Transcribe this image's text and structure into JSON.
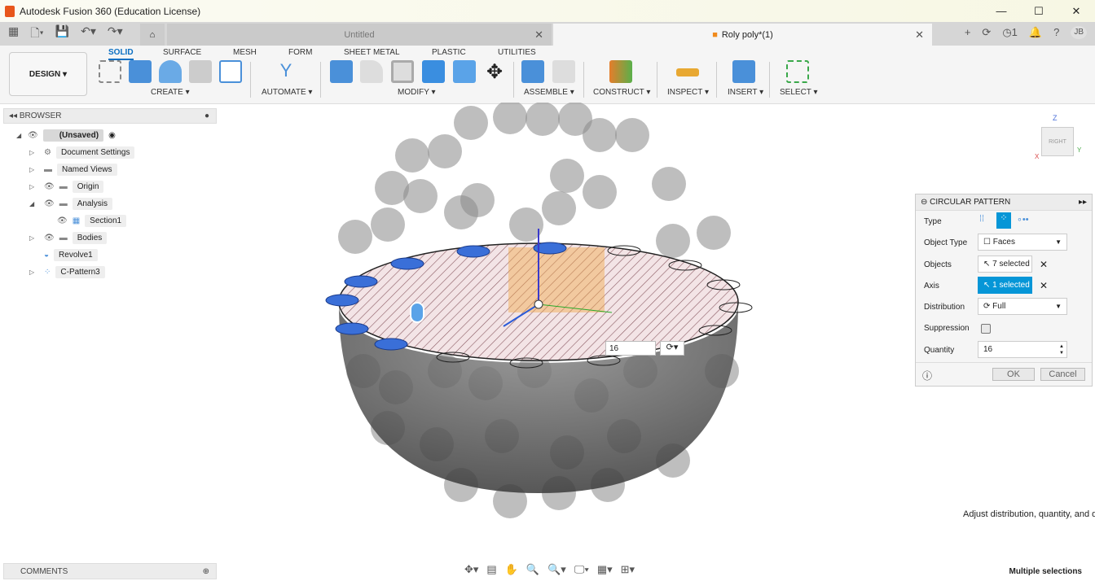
{
  "window": {
    "title": "Autodesk Fusion 360 (Education License)",
    "controls": [
      "—",
      "☐",
      "✕"
    ]
  },
  "tabs": [
    {
      "label": "Untitled",
      "active": false
    },
    {
      "label": "Roly poly*(1)",
      "active": true
    }
  ],
  "user": {
    "jobs": "1",
    "initials": "JB"
  },
  "ribbon": {
    "workspace": "DESIGN ▾",
    "tabs": [
      "SOLID",
      "SURFACE",
      "MESH",
      "FORM",
      "SHEET METAL",
      "PLASTIC",
      "UTILITIES"
    ],
    "groups": [
      "CREATE ▾",
      "AUTOMATE ▾",
      "MODIFY ▾",
      "ASSEMBLE ▾",
      "CONSTRUCT ▾",
      "INSPECT ▾",
      "INSERT ▾",
      "SELECT ▾"
    ]
  },
  "browser": {
    "title": "BROWSER",
    "items": [
      {
        "label": "(Unsaved)",
        "level": 0
      },
      {
        "label": "Document Settings",
        "level": 1
      },
      {
        "label": "Named Views",
        "level": 1
      },
      {
        "label": "Origin",
        "level": 1
      },
      {
        "label": "Analysis",
        "level": 1
      },
      {
        "label": "Section1",
        "level": 2
      },
      {
        "label": "Bodies",
        "level": 1
      },
      {
        "label": "Revolve1",
        "level": 1
      },
      {
        "label": "C-Pattern3",
        "level": 1
      }
    ]
  },
  "comments": {
    "title": "COMMENTS"
  },
  "viewcube": {
    "face": "RIGHT",
    "axes": [
      "Z",
      "X",
      "Y"
    ]
  },
  "canvas": {
    "quantity_input": "16"
  },
  "panel": {
    "title": "CIRCULAR PATTERN",
    "type_label": "Type",
    "object_type_label": "Object Type",
    "object_type": "Faces",
    "objects_label": "Objects",
    "objects": "7 selected",
    "axis_label": "Axis",
    "axis": "1 selected",
    "distribution_label": "Distribution",
    "distribution": "Full",
    "suppression_label": "Suppression",
    "suppression": false,
    "quantity_label": "Quantity",
    "quantity": "16",
    "ok": "OK",
    "cancel": "Cancel",
    "accent": "#0696d7"
  },
  "tooltip": "Adjust distribution, quantity, and di",
  "status": "Multiple selections"
}
